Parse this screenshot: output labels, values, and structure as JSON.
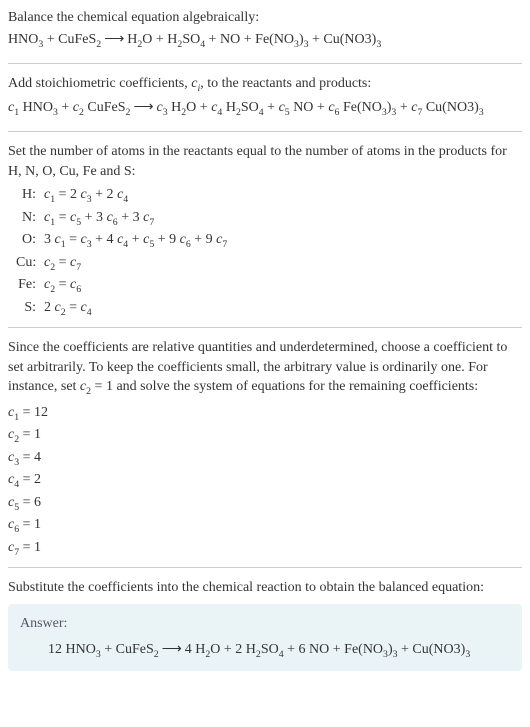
{
  "section1": {
    "intro": "Balance the chemical equation algebraically:",
    "eq_lhs1": "HNO",
    "eq_lhs1_sub": "3",
    "eq_lhs2": " + CuFeS",
    "eq_lhs2_sub": "2",
    "arrow": " ⟶ ",
    "eq_rhs1": "H",
    "eq_rhs1_sub": "2",
    "eq_rhs2": "O + H",
    "eq_rhs2_sub": "2",
    "eq_rhs3": "SO",
    "eq_rhs3_sub": "4",
    "eq_rhs4": " + NO + Fe(NO",
    "eq_rhs4_sub": "3",
    "eq_rhs5": ")",
    "eq_rhs5_sub": "3",
    "eq_rhs6": " + Cu(NO3)",
    "eq_rhs6_sub": "3"
  },
  "section2": {
    "intro_a": "Add stoichiometric coefficients, ",
    "intro_ci_c": "c",
    "intro_ci_i": "i",
    "intro_b": ", to the reactants and products:",
    "c1": "c",
    "c1_sub": "1",
    "t1": " HNO",
    "t1_sub": "3",
    "t2": " + ",
    "c2": "c",
    "c2_sub": "2",
    "t3": " CuFeS",
    "t3_sub": "2",
    "arrow": " ⟶ ",
    "c3": "c",
    "c3_sub": "3",
    "t4": " H",
    "t4_sub": "2",
    "t5": "O + ",
    "c4": "c",
    "c4_sub": "4",
    "t6": " H",
    "t6_sub": "2",
    "t7": "SO",
    "t7_sub": "4",
    "t8": " + ",
    "c5": "c",
    "c5_sub": "5",
    "t9": " NO + ",
    "c6": "c",
    "c6_sub": "6",
    "t10": " Fe(NO",
    "t10_sub": "3",
    "t11": ")",
    "t11_sub": "3",
    "t12": " + ",
    "c7": "c",
    "c7_sub": "7",
    "t13": " Cu(NO3)",
    "t13_sub": "3"
  },
  "section3": {
    "intro": "Set the number of atoms in the reactants equal to the number of atoms in the products for H, N, O, Cu, Fe and S:",
    "rows": {
      "H": {
        "label": "H:",
        "lhs_c": "c",
        "lhs_s": "1",
        "eq": " = 2 ",
        "r1_c": "c",
        "r1_s": "3",
        "r2": " + 2 ",
        "r2_c": "c",
        "r2_s": "4"
      },
      "N": {
        "label": "N:",
        "lhs_c": "c",
        "lhs_s": "1",
        "eq": " = ",
        "r1_c": "c",
        "r1_s": "5",
        "r2": " + 3 ",
        "r2_c": "c",
        "r2_s": "6",
        "r3": " + 3 ",
        "r3_c": "c",
        "r3_s": "7"
      },
      "O": {
        "label": "O:",
        "p1": "3 ",
        "lhs_c": "c",
        "lhs_s": "1",
        "eq": " = ",
        "r1_c": "c",
        "r1_s": "3",
        "r2": " + 4 ",
        "r2_c": "c",
        "r2_s": "4",
        "r3": " + ",
        "r3_c": "c",
        "r3_s": "5",
        "r4": " + 9 ",
        "r4_c": "c",
        "r4_s": "6",
        "r5": " + 9 ",
        "r5_c": "c",
        "r5_s": "7"
      },
      "Cu": {
        "label": "Cu:",
        "lhs_c": "c",
        "lhs_s": "2",
        "eq": " = ",
        "r1_c": "c",
        "r1_s": "7"
      },
      "Fe": {
        "label": "Fe:",
        "lhs_c": "c",
        "lhs_s": "2",
        "eq": " = ",
        "r1_c": "c",
        "r1_s": "6"
      },
      "S": {
        "label": "S:",
        "p1": "2 ",
        "lhs_c": "c",
        "lhs_s": "2",
        "eq": " = ",
        "r1_c": "c",
        "r1_s": "4"
      }
    }
  },
  "section4": {
    "intro_a": "Since the coefficients are relative quantities and underdetermined, choose a coefficient to set arbitrarily. To keep the coefficients small, the arbitrary value is ordinarily one. For instance, set ",
    "intro_c": "c",
    "intro_c_sub": "2",
    "intro_b": " = 1 and solve the system of equations for the remaining coefficients:",
    "coefs": {
      "c1": {
        "c": "c",
        "s": "1",
        "v": " = 12"
      },
      "c2": {
        "c": "c",
        "s": "2",
        "v": " = 1"
      },
      "c3": {
        "c": "c",
        "s": "3",
        "v": " = 4"
      },
      "c4": {
        "c": "c",
        "s": "4",
        "v": " = 2"
      },
      "c5": {
        "c": "c",
        "s": "5",
        "v": " = 6"
      },
      "c6": {
        "c": "c",
        "s": "6",
        "v": " = 1"
      },
      "c7": {
        "c": "c",
        "s": "7",
        "v": " = 1"
      }
    }
  },
  "section5": {
    "intro": "Substitute the coefficients into the chemical reaction to obtain the balanced equation:",
    "answer_label": "Answer:",
    "eq_lhs1": "12 HNO",
    "eq_lhs1_sub": "3",
    "eq_lhs2": " + CuFeS",
    "eq_lhs2_sub": "2",
    "arrow": " ⟶ ",
    "eq_rhs1": "4 H",
    "eq_rhs1_sub": "2",
    "eq_rhs2": "O + 2 H",
    "eq_rhs2_sub": "2",
    "eq_rhs3": "SO",
    "eq_rhs3_sub": "4",
    "eq_rhs4": " + 6 NO + Fe(NO",
    "eq_rhs4_sub": "3",
    "eq_rhs5": ")",
    "eq_rhs5_sub": "3",
    "eq_rhs6": " + Cu(NO3)",
    "eq_rhs6_sub": "3"
  }
}
